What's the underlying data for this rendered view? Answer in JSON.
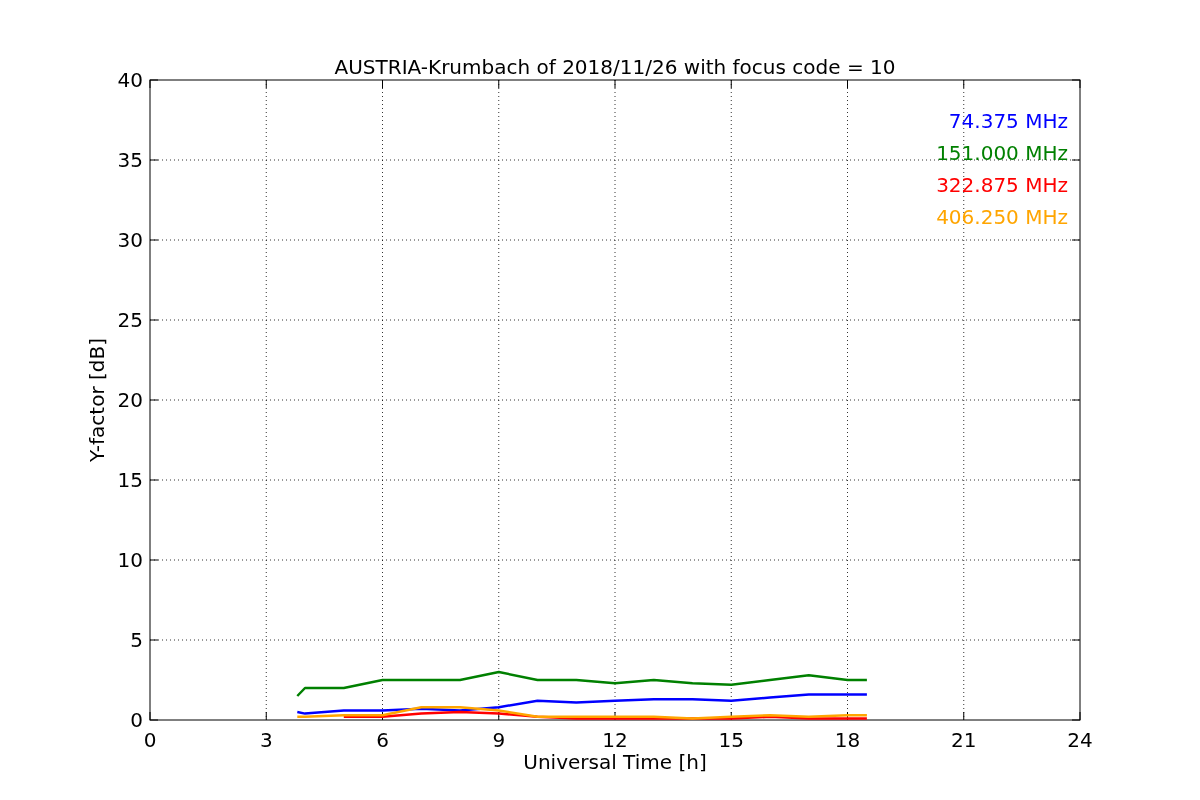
{
  "figure": {
    "chart_data": {
      "type": "line",
      "title": "AUSTRIA-Krumbach of 2018/11/26 with focus code = 10",
      "xlabel": "Universal Time [h]",
      "ylabel": "Y-factor [dB]",
      "x": [
        3.8,
        4,
        5,
        6,
        7,
        8,
        9,
        10,
        11,
        12,
        13,
        14,
        15,
        16,
        17,
        18,
        18.5
      ],
      "series": [
        {
          "name": "74.375 MHz",
          "color": "#0000ff",
          "values": [
            0.5,
            0.4,
            0.6,
            0.6,
            0.7,
            0.6,
            0.8,
            1.2,
            1.1,
            1.2,
            1.3,
            1.3,
            1.2,
            1.4,
            1.6,
            1.6,
            1.6
          ]
        },
        {
          "name": "151.000 MHz",
          "color": "#008000",
          "values": [
            1.5,
            2,
            2,
            2.5,
            2.5,
            2.5,
            3,
            2.5,
            2.5,
            2.3,
            2.5,
            2.3,
            2.2,
            2.5,
            2.8,
            2.5,
            2.5
          ]
        },
        {
          "name": "322.875 MHz",
          "color": "#ff0000",
          "values": [
            null,
            null,
            0.2,
            0.2,
            0.4,
            0.5,
            0.4,
            0.2,
            0.1,
            0.1,
            0.1,
            0.1,
            0.1,
            0.2,
            0.1,
            0.1,
            0.1
          ]
        },
        {
          "name": "406.250 MHz",
          "color": "#ffa500",
          "values": [
            0.2,
            0.2,
            0.3,
            0.3,
            0.8,
            0.8,
            0.6,
            0.2,
            0.2,
            0.2,
            0.2,
            0.1,
            0.2,
            0.3,
            0.2,
            0.3,
            0.3
          ]
        }
      ],
      "grid": true,
      "xlim": [
        0,
        24
      ],
      "ylim": [
        0,
        40
      ],
      "xticks": [
        0,
        3,
        6,
        9,
        12,
        15,
        18,
        21,
        24
      ],
      "yticks": [
        0,
        5,
        10,
        15,
        20,
        25,
        30,
        35,
        40
      ]
    }
  }
}
